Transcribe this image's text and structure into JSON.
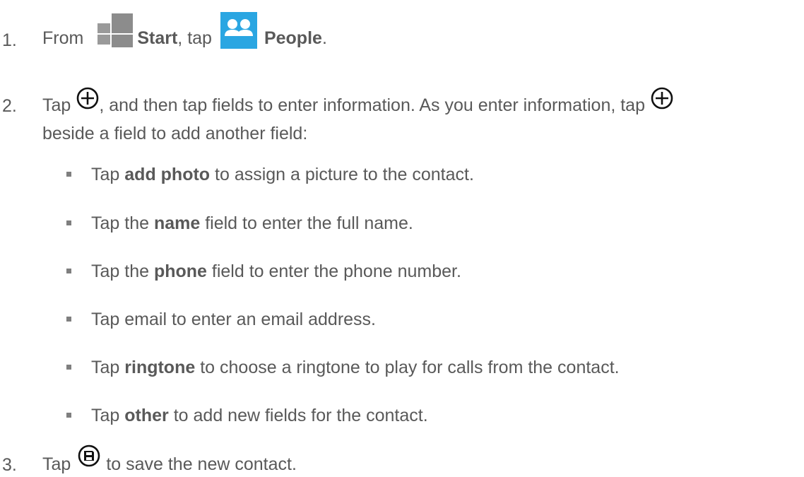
{
  "steps": [
    {
      "number": "1.",
      "from": "From",
      "start": "Start",
      "tap_sep": ", tap",
      "people": "People",
      "end": "."
    },
    {
      "number": "2.",
      "tap": "Tap",
      "line1_rest": ", and then tap fields to enter information. As you enter information, tap",
      "line2": "beside a field to add another field:"
    },
    {
      "number": "3.",
      "tap": "Tap",
      "rest": "to save the new contact."
    }
  ],
  "bullets": [
    {
      "pre": "Tap ",
      "bold": "add photo",
      "post": " to assign a picture to the contact."
    },
    {
      "pre": "Tap the ",
      "bold": "name",
      "post": " field to enter the full name."
    },
    {
      "pre": "Tap the ",
      "bold": "phone",
      "post": " field to enter the phone number."
    },
    {
      "pre": "Tap email to enter an email address.",
      "bold": "",
      "post": ""
    },
    {
      "pre": "Tap ",
      "bold": "ringtone",
      "post": " to choose a ringtone to play for calls from the contact."
    },
    {
      "pre": "Tap ",
      "bold": "other",
      "post": " to add new fields for the contact."
    }
  ],
  "icons": {
    "start": "windows-start-icon",
    "people": "people-tile-icon",
    "add": "add-circle-icon",
    "save": "save-circle-icon"
  },
  "colors": {
    "text": "#595959",
    "tile_blue": "#2aa6e2",
    "start_gray": "#8c8c8c"
  }
}
